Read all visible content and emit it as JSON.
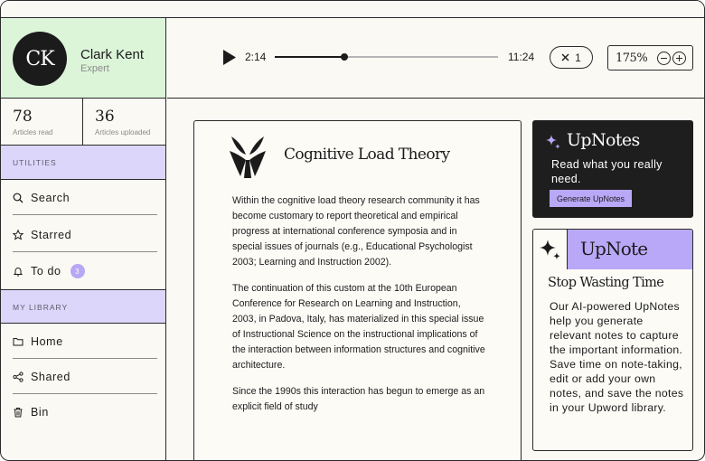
{
  "profile": {
    "initials": "CK",
    "name": "Clark Kent",
    "role": "Expert"
  },
  "stats": [
    {
      "value": "78",
      "label": "Articles read"
    },
    {
      "value": "36",
      "label": "Articles uploaded"
    }
  ],
  "sidebar": {
    "utilities_heading": "UTILITIES",
    "utilities": [
      {
        "label": "Search",
        "icon": "search-icon"
      },
      {
        "label": "Starred",
        "icon": "star-icon"
      },
      {
        "label": "To do",
        "icon": "bell-icon",
        "badge": "3"
      }
    ],
    "library_heading": "MY LIBRARY",
    "library": [
      {
        "label": "Home",
        "icon": "folder-icon"
      },
      {
        "label": "Shared",
        "icon": "share-icon"
      },
      {
        "label": "Bin",
        "icon": "trash-icon"
      }
    ]
  },
  "player": {
    "current": "2:14",
    "total": "11:24",
    "progress": 0.31,
    "speed": "1",
    "zoom": "175%"
  },
  "article": {
    "title": "Cognitive Load Theory",
    "paragraphs": [
      "Within the cognitive load theory research community it has become customary to report theoretical and empirical progress at international conference symposia and in special issues of journals (e.g., Educational Psychologist 2003; Learning and Instruction 2002).",
      "The continuation of this custom at the 10th European Conference for Research on Learning and Instruction, 2003, in Padova, Italy, has materialized in this special issue of Instructional Science on the instructional implications of the interaction between information structures and cognitive architecture.",
      "Since the 1990s this interaction has begun to emerge as an explicit field of study"
    ]
  },
  "promo": {
    "title": "UpNotes",
    "text": "Read what you really need.",
    "button": "Generate UpNotes"
  },
  "upnote": {
    "brand": "UpNote",
    "title": "Stop Wasting Time",
    "body": "Our AI-powered UpNotes help you generate relevant notes to capture the important information. Save time on note-taking, edit or add your own notes, and save the notes in your Upword library."
  },
  "colors": {
    "profile_bg": "#dcf5d9",
    "section_bg": "#ddd6fb",
    "accent": "#b9a8f7",
    "dark": "#1e1e1e"
  }
}
